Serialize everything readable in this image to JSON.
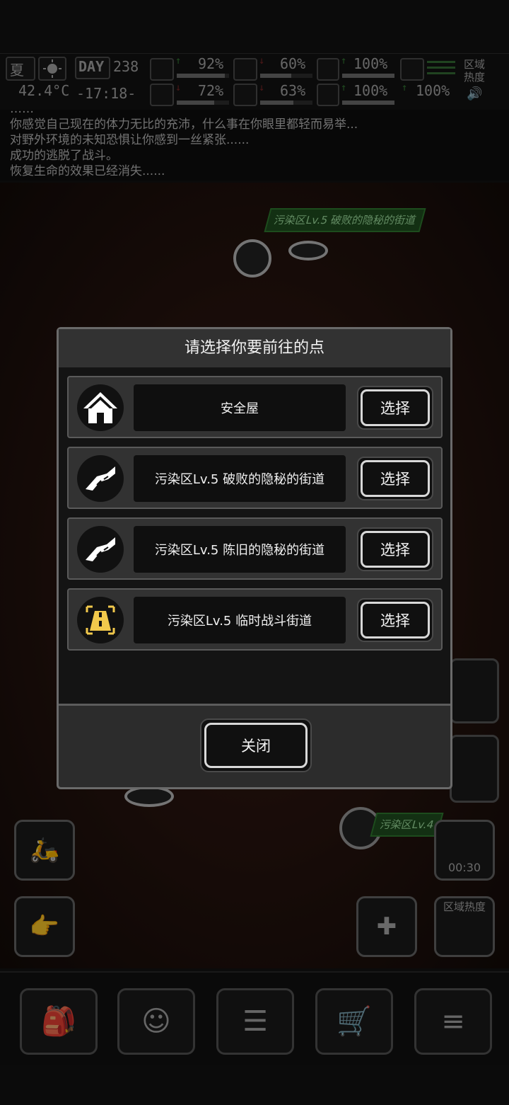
{
  "status": {
    "season": "夏",
    "temperature": "42.4°C",
    "day_label": "DAY",
    "day_number": "238",
    "time": "-17:18-",
    "stats": [
      {
        "name": "health",
        "value": "92%",
        "trend": "up",
        "level": 0.92
      },
      {
        "name": "food",
        "value": "60%",
        "trend": "down",
        "level": 0.6
      },
      {
        "name": "medicine",
        "value": "100%",
        "trend": "up",
        "level": 1.0
      },
      {
        "name": "energy",
        "value": "100%",
        "trend": "up",
        "level": 1.0
      },
      {
        "name": "mental",
        "value": "72%",
        "trend": "down",
        "level": 0.72
      },
      {
        "name": "water",
        "value": "63%",
        "trend": "down",
        "level": 0.63
      },
      {
        "name": "mood",
        "value": "100%",
        "trend": "up",
        "level": 1.0
      }
    ],
    "heat_label": "区域热度"
  },
  "log": {
    "lines": [
      "……",
      "你感觉自己现在的体力无比的充沛，什么事在你眼里都轻而易举...",
      "对野外环境的未知恐惧让你感到一丝紧张......",
      "成功的逃脱了战斗。",
      "恢复生命的效果已经消失......"
    ]
  },
  "map": {
    "top_tag": "污染区Lv.5 破败的隐秘的街道",
    "bottom_tag": "污染区Lv.4",
    "timer": "00:30",
    "heat_button": "区域热度"
  },
  "dialog": {
    "title": "请选择你要前往的点",
    "destinations": [
      {
        "label": "安全屋",
        "icon": "house-icon",
        "action": "选择"
      },
      {
        "label": "污染区Lv.5 破败的隐秘的街道",
        "icon": "road-icon",
        "action": "选择"
      },
      {
        "label": "污染区Lv.5 陈旧的隐秘的街道",
        "icon": "road-icon",
        "action": "选择"
      },
      {
        "label": "污染区Lv.5 临时战斗街道",
        "icon": "battle-road-icon",
        "action": "选择"
      }
    ],
    "close_label": "关闭"
  },
  "colors": {
    "accent_gold": "#f2c94c",
    "tag_green": "#2f7a2f",
    "dialog_bg": "#2c2c2c"
  }
}
